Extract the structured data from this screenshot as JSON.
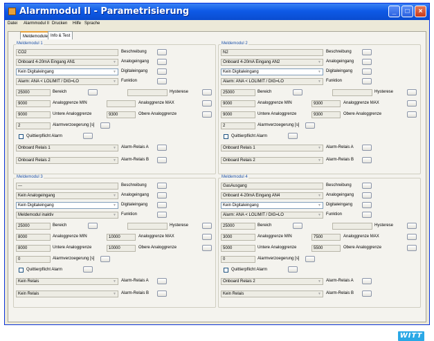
{
  "window": {
    "title": "Alarmmodul II - Parametrisierung"
  },
  "menu": [
    "Datei",
    "Alarmmodul II",
    "Drucken",
    "Hilfe",
    "Sprache"
  ],
  "tabs": [
    "Meldemodule",
    "Info & Test"
  ],
  "labels": {
    "beschreibung": "Beschreibung",
    "analogeingang": "Analogeingang",
    "digitaleingang": "Digitaleingang",
    "funktion": "Funktion",
    "bereich": "Bereich",
    "hysterese": "Hysterese",
    "analog_min": "Analoggrenze MIN",
    "analog_max": "Analoggrenze MAX",
    "untere": "Untere Analoggrenze",
    "obere": "Obere Analoggrenze",
    "verzoegerung": "Alarmverzoegerung [s]",
    "quittier": "Quittierpflicht Alarm",
    "relais_a": "Alarm-Relais A",
    "relais_b": "Alarm-Relais B"
  },
  "modules": [
    {
      "title": "Meldemodul 1",
      "beschreibung": "CO2",
      "analog": "Onboard 4-20mA Eingang AN1",
      "digital": "Kein Digitaleingang",
      "funktion": "Alarm: ANA < LOLIMIT / DIG=LO",
      "bereich": "25000",
      "hysterese": "",
      "min": "9000",
      "max": "",
      "untere": "9000",
      "obere": "9300",
      "verzoegerung": "2",
      "relais_a": "Onboard Relais 1",
      "relais_b": "Onboard Relais 2"
    },
    {
      "title": "Meldemodul 2",
      "beschreibung": "N2",
      "analog": "Onboard 4-20mA Eingang AN2",
      "digital": "Kein Digitaleingang",
      "funktion": "Alarm: ANA < LOLIMIT / DIG=LO",
      "bereich": "25000",
      "hysterese": "",
      "min": "9000",
      "max": "9300",
      "untere": "9000",
      "obere": "9300",
      "verzoegerung": "2",
      "relais_a": "Onboard Relais 1",
      "relais_b": "Onboard Relais 2"
    },
    {
      "title": "Meldemodul 3",
      "beschreibung": "---",
      "analog": "Kein Analogeingang",
      "digital": "Kein Digitaleingang",
      "funktion": "Meldemodul inaktiv",
      "bereich": "25000",
      "hysterese": "",
      "min": "8000",
      "max": "10000",
      "untere": "8000",
      "obere": "10000",
      "verzoegerung": "0",
      "relais_a": "Kein Relais",
      "relais_b": "Kein Relais"
    },
    {
      "title": "Meldemodul 4",
      "beschreibung": "GasAusgang",
      "analog": "Onboard 4-20mA Eingang AN4",
      "digital": "Kein Digitaleingang",
      "funktion": "Alarm: ANA < LOLIMIT / DIG=LO",
      "bereich": "25000",
      "hysterese": "",
      "min": "3000",
      "max": "7500",
      "untere": "5000",
      "obere": "5500",
      "verzoegerung": "0",
      "relais_a": "Onboard Relais 2",
      "relais_b": "Kein Relais"
    }
  ],
  "logo": "WITT",
  "colors": {
    "titlebar": "#0e5ae6",
    "group_title": "#2255aa",
    "logo": "#2aa8e6"
  }
}
